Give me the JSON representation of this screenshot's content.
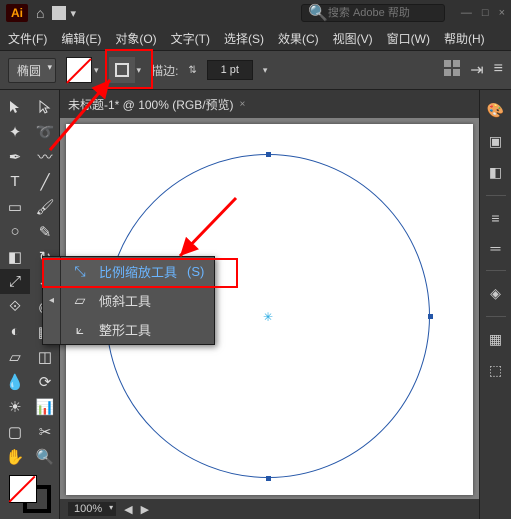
{
  "app": {
    "logo": "Ai"
  },
  "search": {
    "placeholder": "搜索 Adobe 帮助",
    "icon": "🔍"
  },
  "menu": [
    "文件(F)",
    "编辑(E)",
    "对象(O)",
    "文字(T)",
    "选择(S)",
    "效果(C)",
    "视图(V)",
    "窗口(W)",
    "帮助(H)"
  ],
  "control": {
    "shape": "椭圆",
    "stroke_label": "描边:",
    "stroke_weight": "1 pt"
  },
  "tab": {
    "title": "未标题-1* @ 100% (RGB/预览)",
    "close": "×"
  },
  "flyout": {
    "scale": {
      "label": "比例缩放工具",
      "key": "(S)"
    },
    "shear": {
      "label": "倾斜工具"
    },
    "reshape": {
      "label": "整形工具"
    }
  },
  "status": {
    "zoom": "100%"
  },
  "icons": {
    "home": "⌂",
    "dropdown": "▾",
    "arrows": "⇅",
    "select": "▲",
    "direct": "△",
    "wand": "✦",
    "lasso": "➰",
    "pen": "✒",
    "curve": "〰",
    "type": "T",
    "line": "╱",
    "rect": "▭",
    "brush": "🖌",
    "ellipse": "○",
    "pencil": "✎",
    "eraser": "◧",
    "rotate": "↻",
    "scale": "⤢",
    "width": "↔",
    "free": "⟐",
    "shape": "◉",
    "warp": "◐",
    "mesh": "▦",
    "perspective": "▱",
    "gradient": "◫",
    "eyedrop": "💧",
    "blend": "⟳",
    "symbol": "☀",
    "graph": "📊",
    "artboard": "▢",
    "slice": "✂",
    "hand": "✋",
    "zoom": "🔍",
    "properties": "🎨",
    "libraries": "▣",
    "swatches": "◧",
    "brushes": "≡",
    "stroke_p": "═",
    "layers": "◈",
    "align": "▦",
    "pathfinder": "⬚",
    "grid": true,
    "menu": "≡",
    "link": "—",
    "min": "□",
    "close": "×",
    "shear_i": "▱",
    "reshape_i": "⟀",
    "scale_i": "⤡",
    "tear": "◂"
  }
}
